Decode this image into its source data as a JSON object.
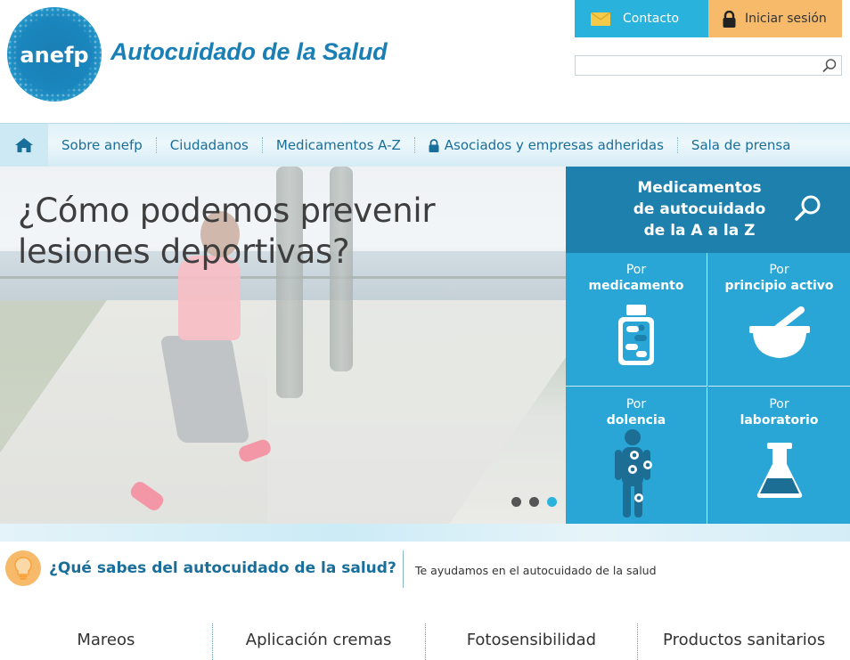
{
  "header": {
    "logo_text": "anefp",
    "site_title": "Autocuidado de la Salud",
    "contact_label": "Contacto",
    "login_label": "Iniciar sesión",
    "search": {
      "value": "",
      "placeholder": ""
    }
  },
  "nav": {
    "home_icon": "home-icon",
    "items": [
      {
        "label": "Sobre anefp"
      },
      {
        "label": "Ciudadanos"
      },
      {
        "label": "Medicamentos A-Z"
      },
      {
        "label": "Asociados y empresas adheridas",
        "icon": "lock-icon"
      },
      {
        "label": "Sala de prensa"
      }
    ]
  },
  "hero": {
    "title_line1": "¿Cómo podemos prevenir",
    "title_line2": "lesiones deportivas?",
    "slides": 3,
    "active_slide": 3
  },
  "medicines": {
    "title_line1": "Medicamentos",
    "title_line2": "de autocuidado",
    "title_line3": "de la A a la Z",
    "cells": [
      {
        "l1": "Por",
        "l2": "medicamento",
        "icon": "pill-bottle-icon"
      },
      {
        "l1": "Por",
        "l2": "principio activo",
        "icon": "mortar-pestle-icon"
      },
      {
        "l1": "Por",
        "l2": "dolencia",
        "icon": "body-icon"
      },
      {
        "l1": "Por",
        "l2": "laboratorio",
        "icon": "flask-icon"
      }
    ]
  },
  "tips": {
    "title": "¿Qué sabes del autocuidado de la salud?",
    "subtitle": "Te ayudamos en el autocuidado de la salud"
  },
  "categories": [
    {
      "label": "Mareos"
    },
    {
      "label": "Aplicación cremas"
    },
    {
      "label": "Fotosensibilidad"
    },
    {
      "label": "Productos sanitarios"
    }
  ],
  "colors": {
    "accent_blue": "#29b3dc",
    "dark_blue": "#1d80ad",
    "orange": "#f7b96a",
    "nav_text": "#1a6e9a"
  }
}
